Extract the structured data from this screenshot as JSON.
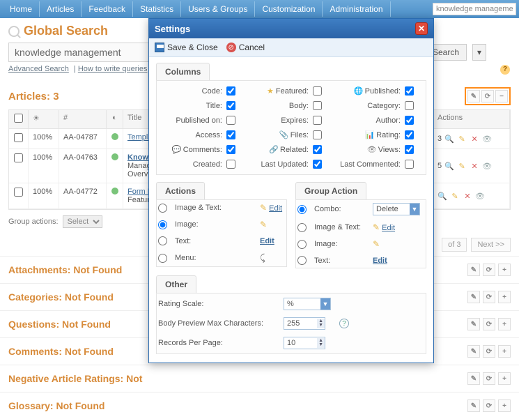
{
  "topnav": {
    "tabs": [
      "Home",
      "Articles",
      "Feedback",
      "Statistics",
      "Users & Groups",
      "Customization",
      "Administration"
    ],
    "mini_search": "knowledge management"
  },
  "gsearch": {
    "title": "Global Search",
    "value": "knowledge management",
    "search_btn": "Search",
    "adv_link": "Advanced Search",
    "howto_link": "How to write queries"
  },
  "articles": {
    "heading": "Articles: 3",
    "cols": {
      "pct": "%",
      "num": "#",
      "title": "Title",
      "actions": "Actions"
    },
    "rows": [
      {
        "pct": "100%",
        "code": "AA-04787",
        "title": "Templa",
        "sub": "",
        "bold": false,
        "num": "3"
      },
      {
        "pct": "100%",
        "code": "AA-04763",
        "title": "Knowl",
        "sub": "Manage\nOvervie",
        "bold": true,
        "num": "5"
      },
      {
        "pct": "100%",
        "code": "AA-04772",
        "title": "Form M",
        "sub": "Feature",
        "bold": false,
        "num": ""
      }
    ],
    "group_label": "Group actions:",
    "group_select": "Select",
    "pager": {
      "of": "of 3",
      "next": "Next >>"
    }
  },
  "nf": {
    "attachments": "Attachments: Not Found",
    "categories": "Categories: Not Found",
    "questions": "Questions: Not Found",
    "comments": "Comments: Not Found",
    "negative": "Negative Article Ratings: Not",
    "glossary": "Glossary: Not Found"
  },
  "modal": {
    "title": "Settings",
    "save": "Save & Close",
    "cancel": "Cancel",
    "columns_tab": "Columns",
    "columns": [
      {
        "l1": "Code:",
        "c1": true,
        "l2": "Featured:",
        "c2": false,
        "l3": "Published:",
        "c3": true,
        "i2": "star",
        "i3": "globe"
      },
      {
        "l1": "Title:",
        "c1": true,
        "l2": "Body:",
        "c2": false,
        "l3": "Category:",
        "c3": false
      },
      {
        "l1": "Published on:",
        "c1": false,
        "l2": "Expires:",
        "c2": false,
        "l3": "Author:",
        "c3": true
      },
      {
        "l1": "Access:",
        "c1": true,
        "l2": "Files:",
        "c2": false,
        "l3": "Rating:",
        "c3": true,
        "i2": "clip",
        "i3": "bars"
      },
      {
        "l1": "Comments:",
        "c1": true,
        "l2": "Related:",
        "c2": true,
        "l3": "Views:",
        "c3": true,
        "i1": "bubble",
        "i2": "rel",
        "i3": "eye"
      },
      {
        "l1": "Created:",
        "c1": false,
        "l2": "Last Updated:",
        "c2": true,
        "l3": "Last Commented:",
        "c3": false
      }
    ],
    "actions_tab": "Actions",
    "actions": {
      "image_text": "Image & Text:",
      "image": "Image:",
      "text": "Text:",
      "menu": "Menu:",
      "edit": "Edit"
    },
    "group_tab": "Group Action",
    "group": {
      "combo": "Combo:",
      "combo_val": "Delete",
      "image_text": "Image & Text:",
      "image": "Image:",
      "text": "Text:",
      "edit": "Edit"
    },
    "other_tab": "Other",
    "other": {
      "rating_scale": "Rating Scale:",
      "rating_val": "%",
      "body_preview": "Body Preview Max Characters:",
      "body_val": "255",
      "rpp": "Records Per Page:",
      "rpp_val": "10"
    }
  }
}
